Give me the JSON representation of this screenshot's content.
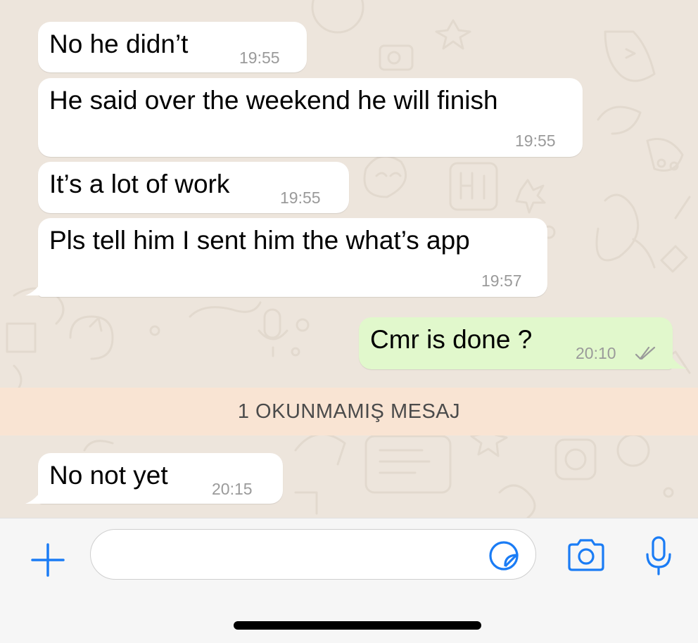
{
  "colors": {
    "chat_background": "#ede5dc",
    "incoming_bubble": "#ffffff",
    "outgoing_bubble": "#e1f8cc",
    "unread_banner": "#f9e4d3",
    "accent_blue": "#1a7cf5",
    "ticks": "#9a9a9a"
  },
  "messages": [
    {
      "direction": "incoming",
      "text": "No he didn’t",
      "time": "19:55"
    },
    {
      "direction": "incoming",
      "text": "He said over the weekend he will finish",
      "time": "19:55"
    },
    {
      "direction": "incoming",
      "text": "It’s a lot of work",
      "time": "19:55"
    },
    {
      "direction": "incoming",
      "text": "Pls tell him I sent him the what’s app",
      "time": "19:57"
    },
    {
      "direction": "outgoing",
      "text": "Cmr is done ?",
      "time": "20:10",
      "status_icon": "double-check-icon"
    },
    {
      "direction": "incoming",
      "text": "No not yet",
      "time": "20:15"
    }
  ],
  "unread_banner": {
    "label": "1 OKUNMAMIŞ MESAJ"
  },
  "input_bar": {
    "message_field": {
      "value": "",
      "placeholder": ""
    },
    "icons": [
      "plus-icon",
      "sticker-icon",
      "camera-icon",
      "microphone-icon"
    ]
  }
}
